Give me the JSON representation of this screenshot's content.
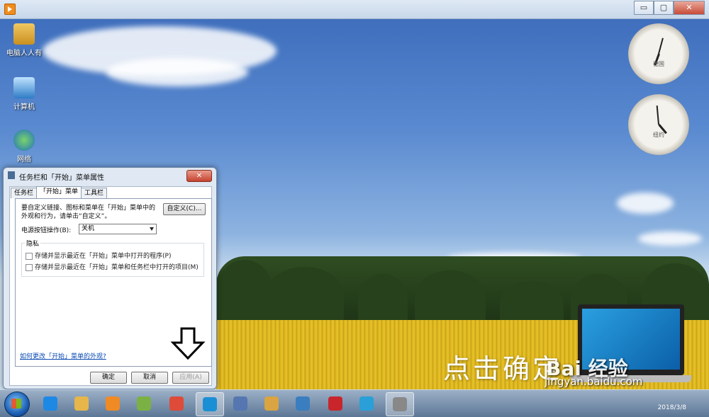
{
  "window": {
    "controls": {
      "minimize": "▭",
      "maximize": "▢",
      "close": "✕"
    }
  },
  "desktop": {
    "icons": [
      {
        "label": "电脑人人有"
      },
      {
        "label": "计算机"
      },
      {
        "label": "网络"
      }
    ],
    "clocks": [
      {
        "label": "德国"
      },
      {
        "label": "纽约"
      }
    ],
    "overlay_text": "点击确定",
    "watermark": "Bai 经验",
    "watermark_url": "jingyan.baidu.com"
  },
  "dialog": {
    "title": "任务栏和「开始」菜单属性",
    "close_label": "✕",
    "tabs": [
      {
        "label": "任务栏",
        "active": false
      },
      {
        "label": "「开始」菜单",
        "active": true
      },
      {
        "label": "工具栏",
        "active": false
      }
    ],
    "description": "要自定义链接、图标和菜单在「开始」菜单中的外观和行为，请单击“自定义”。",
    "customize_button": "自定义(C)...",
    "power_label": "电源按钮操作(B):",
    "power_value": "关机",
    "privacy_title": "隐私",
    "checkboxes": [
      {
        "label": "存储并显示最近在「开始」菜单中打开的程序(P)",
        "checked": false
      },
      {
        "label": "存储并显示最近在「开始」菜单和任务栏中打开的项目(M)",
        "checked": false
      }
    ],
    "help_link": "如何更改「开始」菜单的外观?",
    "buttons": {
      "ok": "确定",
      "cancel": "取消",
      "apply": "应用(A)"
    }
  },
  "taskbar": {
    "items": [
      {
        "icon": "internet-explorer-icon",
        "color": "#1e88e5"
      },
      {
        "icon": "file-explorer-icon",
        "color": "#e6b64a"
      },
      {
        "icon": "media-player-icon",
        "color": "#f08a24"
      },
      {
        "icon": "folder-icon",
        "color": "#7bb045"
      },
      {
        "icon": "chrome-icon",
        "color": "#de4b39"
      },
      {
        "icon": "browser-icon",
        "color": "#1b8fd6"
      },
      {
        "icon": "document-icon",
        "color": "#5576b0"
      },
      {
        "icon": "paint-icon",
        "color": "#d9a441"
      },
      {
        "icon": "remote-desktop-icon",
        "color": "#3a7ebf"
      },
      {
        "icon": "chess-icon",
        "color": "#c8262b"
      },
      {
        "icon": "network-app-icon",
        "color": "#2a9fd8"
      },
      {
        "icon": "device-icon",
        "color": "#888888"
      }
    ],
    "date": "2018/3/8"
  }
}
